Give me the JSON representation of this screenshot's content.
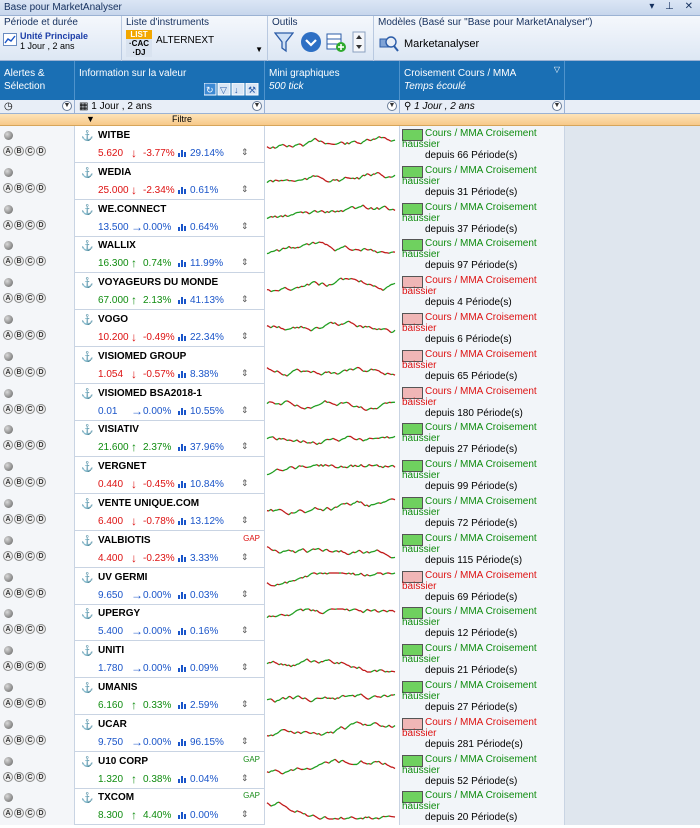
{
  "window": {
    "title": "Base pour MarketAnalyser",
    "buttons": "▾ ⊥ ✕"
  },
  "toolbar": {
    "period_header": "Période et durée",
    "unit_main": "Unité Principale",
    "unit_sub": "1 Jour , 2 ans",
    "list_header": "Liste d'instruments",
    "list_logo": [
      "LIST",
      "·CAC",
      "·DJ"
    ],
    "list_name": "ALTERNEXT",
    "tools_header": "Outils",
    "models_header": "Modèles (Basé sur \"Base pour MarketAnalyser\")",
    "model_name": "Marketanalyser"
  },
  "columns": {
    "alerts": "Alertes & Sélection",
    "info": "Information sur la valeur",
    "mini": "Mini graphiques",
    "mini_sub": "500 tick",
    "cross": "Croisement Cours / MMA",
    "cross_sub": "Temps écoulé"
  },
  "filter": {
    "period_value": "1 Jour , 2 ans",
    "cross_value": "1 Jour , 2 ans",
    "label": "Filtre"
  },
  "rows": [
    {
      "name": "WITBE",
      "price": "5.620",
      "dir": "down",
      "chg": "-3.77%",
      "vol": "29.14%",
      "gap": "",
      "bull": true,
      "since": "depuis 66 Période(s)"
    },
    {
      "name": "WEDIA",
      "price": "25.000",
      "dir": "down",
      "chg": "-2.34%",
      "vol": "0.61%",
      "gap": "",
      "bull": true,
      "since": "depuis 31 Période(s)"
    },
    {
      "name": "WE.CONNECT",
      "price": "13.500",
      "dir": "flat",
      "chg": "0.00%",
      "vol": "0.64%",
      "gap": "",
      "bull": true,
      "since": "depuis 37 Période(s)"
    },
    {
      "name": "WALLIX",
      "price": "16.300",
      "dir": "up",
      "chg": "0.74%",
      "vol": "11.99%",
      "gap": "",
      "bull": true,
      "since": "depuis 97 Période(s)"
    },
    {
      "name": "VOYAGEURS DU MONDE",
      "price": "67.000",
      "dir": "up",
      "chg": "2.13%",
      "vol": "41.13%",
      "gap": "",
      "bull": false,
      "since": "depuis 4 Période(s)"
    },
    {
      "name": "VOGO",
      "price": "10.200",
      "dir": "down",
      "chg": "-0.49%",
      "vol": "22.34%",
      "gap": "",
      "bull": false,
      "since": "depuis 6 Période(s)"
    },
    {
      "name": "VISIOMED GROUP",
      "price": "1.054",
      "dir": "down",
      "chg": "-0.57%",
      "vol": "8.38%",
      "gap": "",
      "bull": false,
      "since": "depuis 65 Période(s)"
    },
    {
      "name": "VISIOMED BSA2018-1",
      "price": "0.01",
      "dir": "flat",
      "chg": "0.00%",
      "vol": "10.55%",
      "gap": "",
      "bull": false,
      "since": "depuis 180 Période(s)"
    },
    {
      "name": "VISIATIV",
      "price": "21.600",
      "dir": "up",
      "chg": "2.37%",
      "vol": "37.96%",
      "gap": "",
      "bull": true,
      "since": "depuis 27 Période(s)"
    },
    {
      "name": "VERGNET",
      "price": "0.440",
      "dir": "down",
      "chg": "-0.45%",
      "vol": "10.84%",
      "gap": "",
      "bull": true,
      "since": "depuis 99 Période(s)"
    },
    {
      "name": "VENTE UNIQUE.COM",
      "price": "6.400",
      "dir": "down",
      "chg": "-0.78%",
      "vol": "13.12%",
      "gap": "",
      "bull": true,
      "since": "depuis 72 Période(s)"
    },
    {
      "name": "VALBIOTIS",
      "price": "4.400",
      "dir": "down",
      "chg": "-0.23%",
      "vol": "3.33%",
      "gap": "GAP",
      "gapColor": "red",
      "bull": true,
      "since": "depuis 115 Période(s)"
    },
    {
      "name": "UV GERMI",
      "price": "9.650",
      "dir": "flat",
      "chg": "0.00%",
      "vol": "0.03%",
      "gap": "",
      "bull": false,
      "since": "depuis 69 Période(s)"
    },
    {
      "name": "UPERGY",
      "price": "5.400",
      "dir": "flat",
      "chg": "0.00%",
      "vol": "0.16%",
      "gap": "",
      "bull": true,
      "since": "depuis 12 Période(s)"
    },
    {
      "name": "UNITI",
      "price": "1.780",
      "dir": "flat",
      "chg": "0.00%",
      "vol": "0.09%",
      "gap": "",
      "bull": true,
      "since": "depuis 21 Période(s)"
    },
    {
      "name": "UMANIS",
      "price": "6.160",
      "dir": "up",
      "chg": "0.33%",
      "vol": "2.59%",
      "gap": "",
      "bull": true,
      "since": "depuis 27 Période(s)"
    },
    {
      "name": "UCAR",
      "price": "9.750",
      "dir": "flat",
      "chg": "0.00%",
      "vol": "96.15%",
      "gap": "",
      "bull": false,
      "since": "depuis 281 Période(s)"
    },
    {
      "name": "U10 CORP",
      "price": "1.320",
      "dir": "up",
      "chg": "0.38%",
      "vol": "0.04%",
      "gap": "GAP",
      "gapColor": "green",
      "bull": true,
      "since": "depuis 52 Période(s)"
    },
    {
      "name": "TXCOM",
      "price": "8.300",
      "dir": "up",
      "chg": "4.40%",
      "vol": "0.00%",
      "gap": "GAP",
      "gapColor": "green",
      "bull": true,
      "since": "depuis 20 Période(s)"
    }
  ],
  "cross_texts": {
    "label": "Cours / MMA Croisement",
    "bull": "haussier",
    "bear": "baissier"
  },
  "abcd": [
    "A",
    "B",
    "C",
    "D"
  ],
  "colors": {
    "up": "#0f8c0f",
    "down": "#d11111",
    "flat": "#1a55c9",
    "header": "#1a6fb4"
  }
}
